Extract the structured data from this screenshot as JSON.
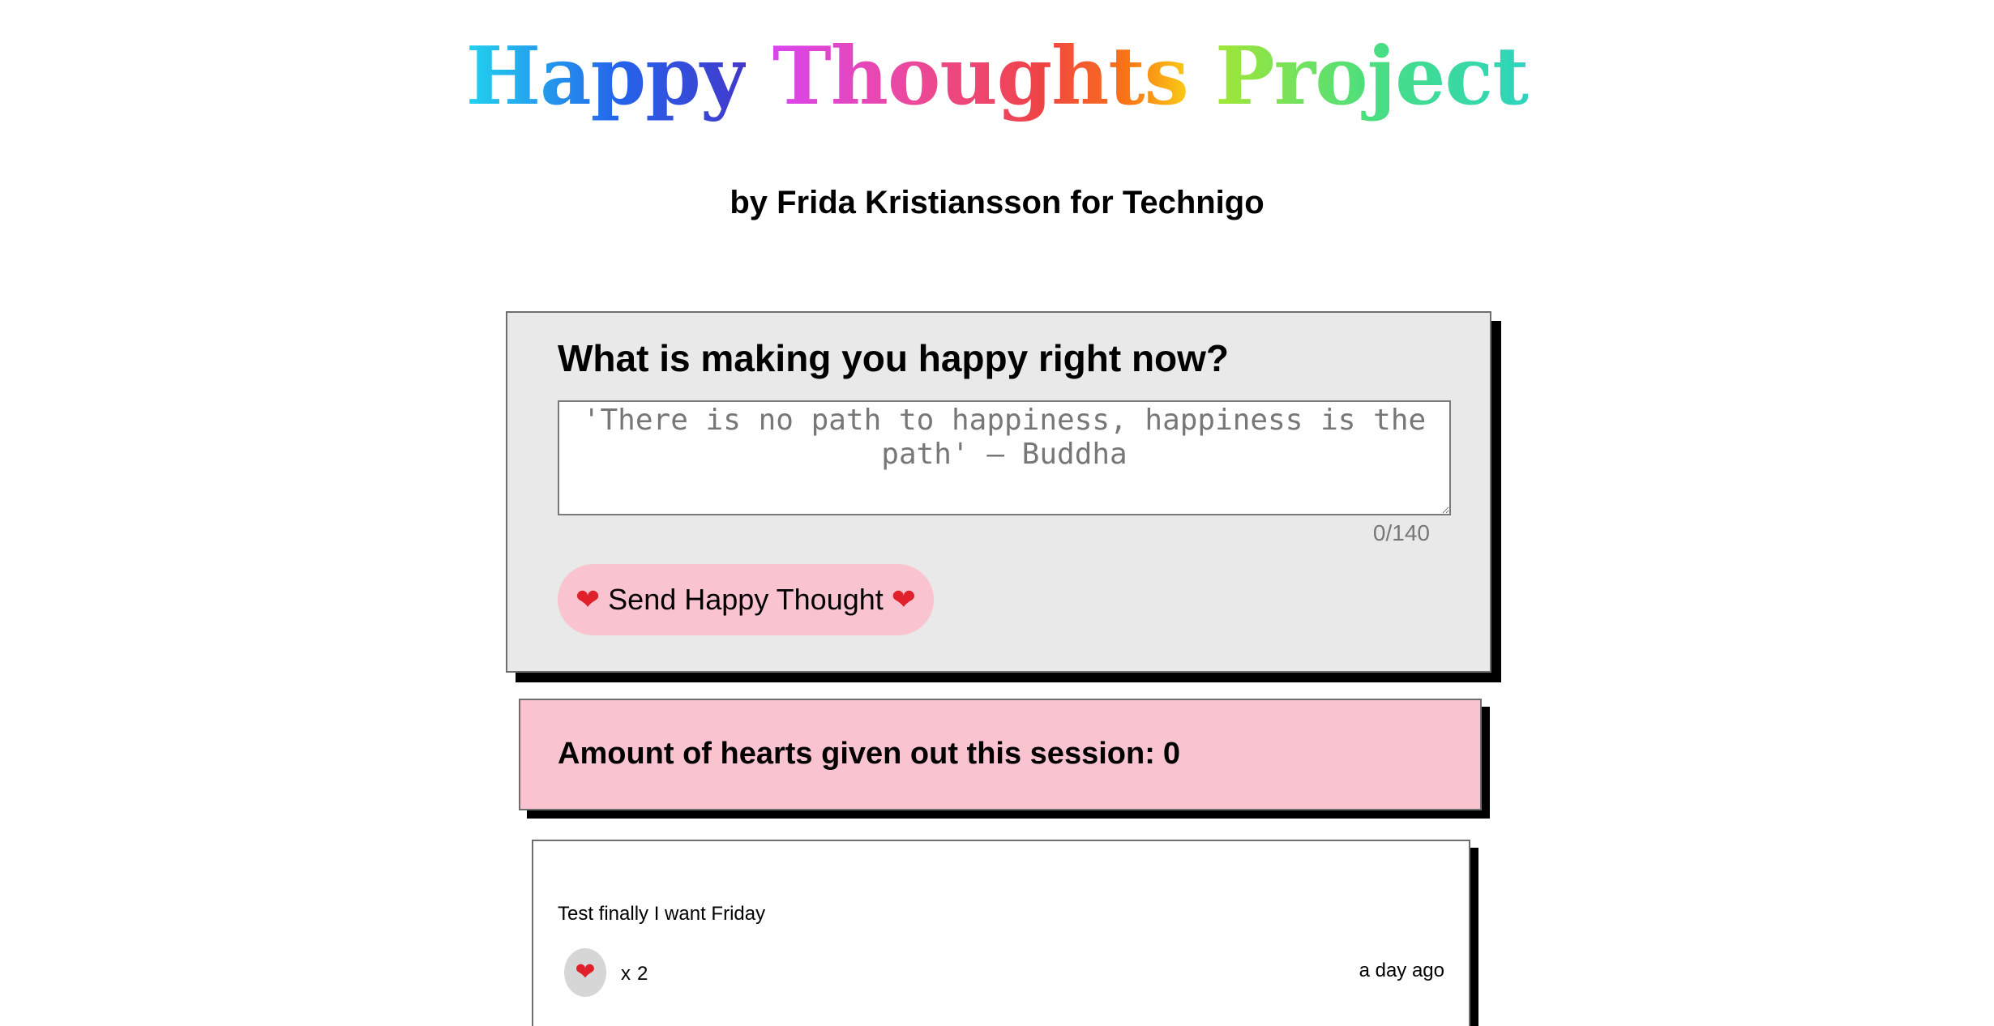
{
  "header": {
    "title_words": [
      "Happy",
      "Thoughts",
      "Project"
    ],
    "byline": "by Frida Kristiansson for Technigo"
  },
  "form": {
    "question": "What is making you happy right now?",
    "input_value": "",
    "input_placeholder": "'There is no path to happiness, happiness is the path' – Buddha",
    "char_count": "0/140",
    "submit_label": "Send Happy Thought",
    "submit_icon": "heart-emoji"
  },
  "session": {
    "hearts_label": "Amount of hearts given out this session:",
    "hearts_count": "0"
  },
  "thoughts": [
    {
      "message": "Test finally I want Friday",
      "likes_prefix": "x",
      "likes": "2",
      "time_ago": "a day ago"
    }
  ],
  "colors": {
    "form_background": "#e9e9e9",
    "accent_pink": "#f9c4d0",
    "like_button": "#d6d6d6",
    "heart": "#e0202a",
    "shadow": "#000000"
  }
}
